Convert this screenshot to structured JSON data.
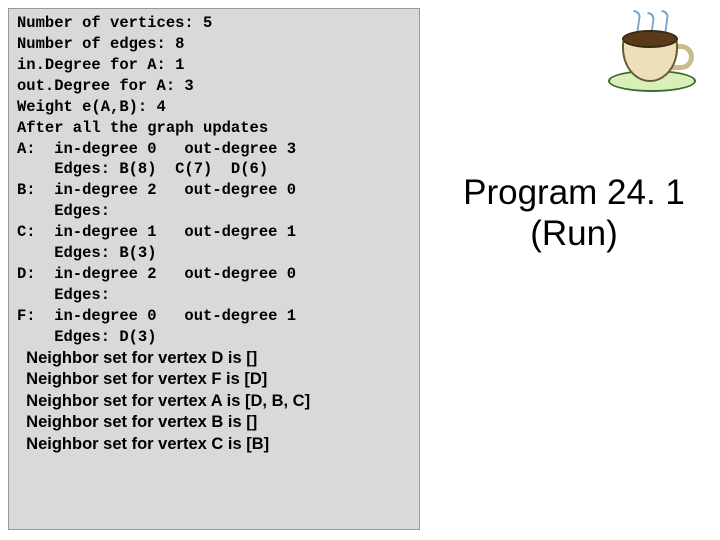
{
  "code": {
    "l0": "Number of vertices: 5",
    "l1": "Number of edges: 8",
    "l2": "in.Degree for A: 1",
    "l3": "out.Degree for A: 3",
    "l4": "Weight e(A,B): 4",
    "l5": "After all the graph updates",
    "l6": "A:  in-degree 0   out-degree 3",
    "l7": "    Edges: B(8)  C(7)  D(6)",
    "l8": "B:  in-degree 2   out-degree 0",
    "l9": "    Edges:",
    "l10": "C:  in-degree 1   out-degree 1",
    "l11": "    Edges: B(3)",
    "l12": "D:  in-degree 2   out-degree 0",
    "l13": "    Edges:",
    "l14": "F:  in-degree 0   out-degree 1",
    "l15": "    Edges: D(3)"
  },
  "neighbors": {
    "n0": "  Neighbor set for vertex D is []",
    "n1": "  Neighbor set for vertex F is [D]",
    "n2": "  Neighbor set for vertex A is [D, B, C]",
    "n3": "  Neighbor set for vertex B is []",
    "n4": "  Neighbor set for vertex C is [B]"
  },
  "title": {
    "line1": "Program 24. 1",
    "line2": "(Run)"
  },
  "art": {
    "name": "coffee-cup-clipart"
  }
}
